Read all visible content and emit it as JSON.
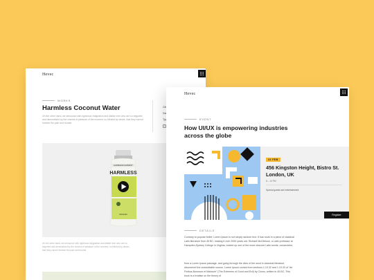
{
  "back_page": {
    "logo": "Hevec",
    "eyebrow": "WORKS",
    "title": "Harmless Coconut Water",
    "description": "On the other hand, we denounce with righteous indignation and dislike men who are so beguiled and demoralized by the charms of pleasure of the moment, so blinded by desire, that they cannot foresee the pain and trouble.",
    "side_items": [
      "Client",
      "Date",
      "Type"
    ],
    "caption": "On the other hand, we denounce with righteous indignation and dislike men who are so beguiled and demoralized by the charms of pleasure of the moment, so blinded by desire, that they cannot foresee the pain and trouble.",
    "bottle": {
      "brand_line": "HARMLESS HARVEST",
      "big_text": "HARMLESS",
      "label_bottom": "ORGANIC",
      "colors": {
        "cap": "#d9d9d9",
        "bottle": "#f4f4f0",
        "label": "#c6d94f",
        "play": "#111111"
      }
    }
  },
  "front_page": {
    "logo": "Hevec",
    "eyebrow": "EVENT",
    "title": "How UI/UX is empowering industries across the globe",
    "event": {
      "date_badge": "22 FEB",
      "address": "456 Kingston Height, Bistro St. London, UK",
      "time": "8 – 10 PM",
      "speakers": "Special guests and entertainment",
      "register_label": "Register"
    },
    "details_eyebrow": "DETAILS",
    "paragraphs": [
      "Contrary to popular belief, Lorem Ipsum is not simply random text. It has roots in a piece of classical Latin literature from 45 BC, making it over 2000 years old. Richard McClintock, a Latin professor at Hampden-Sydney College in Virginia, looked up one of the more obscure Latin words, consectetur,",
      "from a Lorem Ipsum passage, and going through the cites of the word in classical literature, discovered the undoubtable source. Lorem Ipsum comes from sections 1.10.32 and 1.10.33 of \"de Finibus Bonorum et Malorum\" (The Extremes of Good and Evil) by Cicero, written in 45 BC. This book is a treatise on the theory of"
    ]
  },
  "colors": {
    "background": "#FBC957",
    "accent_yellow": "#F5B82E",
    "accent_blue": "#9CC8F2",
    "dark": "#111111"
  }
}
